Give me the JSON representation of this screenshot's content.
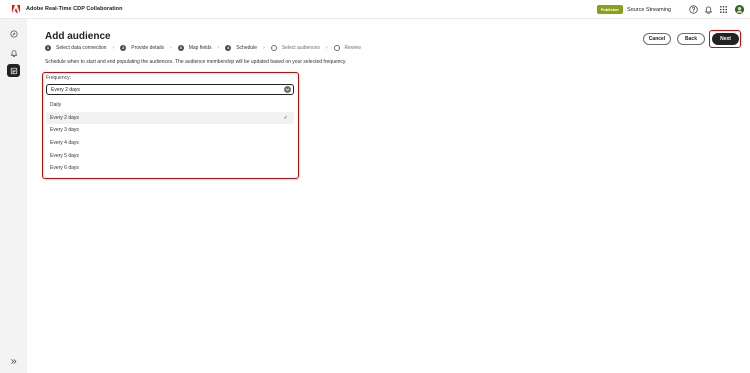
{
  "app": {
    "title": "Adobe Real-Time CDP Collaboration",
    "badge": "Publisher",
    "org_name": "Source Streaming"
  },
  "colors": {
    "logo": "#eb1000",
    "badge_bg": "#8aa01a",
    "highlight": "#d00000",
    "primary_button": "#222222"
  },
  "icons": [
    "adobe-logo-icon",
    "help-icon",
    "bell-icon",
    "apps-grid-icon",
    "avatar",
    "explore-icon",
    "bell-rail-icon",
    "audience-icon",
    "expand-rail-icon"
  ],
  "page": {
    "title": "Add audience",
    "description": "Schedule when to start and end populating the audiences. The audience membership will be updated based on your selected frequency."
  },
  "steps": [
    {
      "number": "1",
      "label": "Select data connection",
      "state": "done"
    },
    {
      "number": "2",
      "label": "Provide details",
      "state": "done"
    },
    {
      "number": "3",
      "label": "Map fields",
      "state": "done"
    },
    {
      "number": "4",
      "label": "Schedule",
      "state": "current"
    },
    {
      "number": "",
      "label": "Select audiences",
      "state": "pending"
    },
    {
      "number": "",
      "label": "Review",
      "state": "pending"
    }
  ],
  "buttons": {
    "cancel": "Cancel",
    "back": "Back",
    "next": "Next"
  },
  "frequency": {
    "label": "Frequency:",
    "value": "Every 2 days",
    "options": [
      "Daily",
      "Every 2 days",
      "Every 3 days",
      "Every 4 days",
      "Every 5 days",
      "Every 6 days"
    ],
    "selected_index": 1
  }
}
